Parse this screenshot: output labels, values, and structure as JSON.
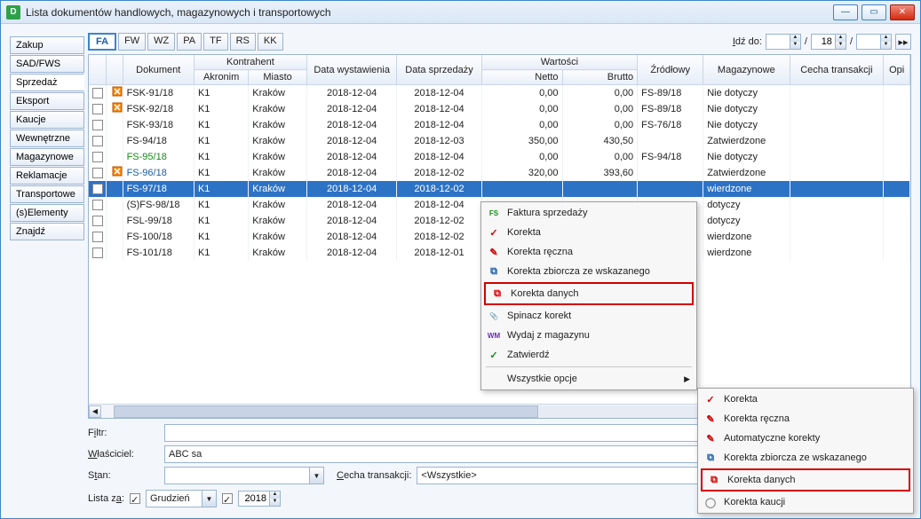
{
  "window": {
    "title": "Lista dokumentów handlowych, magazynowych i transportowych"
  },
  "sidetabs": [
    "Zakup",
    "SAD/FWS",
    "Sprzedaż",
    "Eksport",
    "Kaucje",
    "Wewnętrzne",
    "Magazynowe",
    "Reklamacje",
    "Transportowe",
    "(s)Elementy",
    "Znajdź"
  ],
  "sidetab_active": 2,
  "toptabs": [
    "FA",
    "FW",
    "WZ",
    "PA",
    "TF",
    "RS",
    "KK"
  ],
  "toptab_active": 0,
  "goto": {
    "label": "Idź do:",
    "val1": "",
    "val2": "18",
    "val3": ""
  },
  "columns": {
    "dokument": "Dokument",
    "kontrahent_group": "Kontrahent",
    "akronim": "Akronim",
    "miasto": "Miasto",
    "data_wyst": "Data wystawienia",
    "data_sprz": "Data sprzedaży",
    "wartosci_group": "Wartości",
    "netto": "Netto",
    "brutto": "Brutto",
    "zrodlowy": "Źródłowy",
    "magazynowe": "Magazynowe",
    "cecha": "Cecha transakcji",
    "opi": "Opi"
  },
  "rows": [
    {
      "flag": "r",
      "doc": "FSK-91/18",
      "akr": "K1",
      "miasto": "Kraków",
      "dw": "2018-12-04",
      "ds": "2018-12-04",
      "netto": "0,00",
      "brutto": "0,00",
      "zr": "FS-89/18",
      "mag": "Nie dotyczy"
    },
    {
      "flag": "r",
      "doc": "FSK-92/18",
      "akr": "K1",
      "miasto": "Kraków",
      "dw": "2018-12-04",
      "ds": "2018-12-04",
      "netto": "0,00",
      "brutto": "0,00",
      "zr": "FS-89/18",
      "mag": "Nie dotyczy"
    },
    {
      "flag": "",
      "doc": "FSK-93/18",
      "akr": "K1",
      "miasto": "Kraków",
      "dw": "2018-12-04",
      "ds": "2018-12-04",
      "netto": "0,00",
      "brutto": "0,00",
      "zr": "FS-76/18",
      "mag": "Nie dotyczy"
    },
    {
      "flag": "",
      "doc": "FS-94/18",
      "akr": "K1",
      "miasto": "Kraków",
      "dw": "2018-12-04",
      "ds": "2018-12-03",
      "netto": "350,00",
      "brutto": "430,50",
      "zr": "",
      "mag": "Zatwierdzone"
    },
    {
      "flag": "",
      "doc": "FS-95/18",
      "cls": "doc-green",
      "akr": "K1",
      "miasto": "Kraków",
      "dw": "2018-12-04",
      "ds": "2018-12-04",
      "netto": "0,00",
      "brutto": "0,00",
      "zr": "FS-94/18",
      "mag": "Nie dotyczy"
    },
    {
      "flag": "r",
      "doc": "FS-96/18",
      "cls": "doc-blue",
      "akr": "K1",
      "miasto": "Kraków",
      "dw": "2018-12-04",
      "ds": "2018-12-02",
      "netto": "320,00",
      "brutto": "393,60",
      "zr": "",
      "mag": "Zatwierdzone"
    },
    {
      "flag": "",
      "doc": "FS-97/18",
      "akr": "K1",
      "miasto": "Kraków",
      "dw": "2018-12-04",
      "ds": "2018-12-02",
      "netto": "",
      "brutto": "",
      "zr": "",
      "mag": "wierdzone",
      "sel": true
    },
    {
      "flag": "",
      "doc": "(S)FS-98/18",
      "akr": "K1",
      "miasto": "Kraków",
      "dw": "2018-12-04",
      "ds": "2018-12-04",
      "netto": "",
      "brutto": "",
      "zr": "",
      "mag": "dotyczy"
    },
    {
      "flag": "",
      "doc": "FSL-99/18",
      "akr": "K1",
      "miasto": "Kraków",
      "dw": "2018-12-04",
      "ds": "2018-12-02",
      "netto": "",
      "brutto": "",
      "zr": "",
      "mag": "dotyczy"
    },
    {
      "flag": "",
      "doc": "FS-100/18",
      "akr": "K1",
      "miasto": "Kraków",
      "dw": "2018-12-04",
      "ds": "2018-12-02",
      "netto": "",
      "brutto": "",
      "zr": "",
      "mag": "wierdzone"
    },
    {
      "flag": "",
      "doc": "FS-101/18",
      "akr": "K1",
      "miasto": "Kraków",
      "dw": "2018-12-04",
      "ds": "2018-12-01",
      "netto": "",
      "brutto": "",
      "zr": "",
      "mag": "wierdzone"
    }
  ],
  "filters": {
    "filtr_label": "Filtr:",
    "wlasciciel_label": "Właściciel:",
    "wlasciciel_value": "ABC sa",
    "stan_label": "Stan:",
    "cecha_label": "Cecha transakcji:",
    "cecha_value": "<Wszystkie>",
    "lista_za": "Lista za:",
    "miesiac": "Grudzień",
    "rok": "2018"
  },
  "context1": {
    "items": [
      {
        "icon": "FS",
        "icolor": "#178a17",
        "label": "Faktura sprzedaży"
      },
      {
        "icon": "✓",
        "icolor": "#d40000",
        "label": "Korekta"
      },
      {
        "icon": "✎",
        "icolor": "#d40000",
        "label": "Korekta ręczna"
      },
      {
        "icon": "⧉",
        "icolor": "#1d5fa8",
        "label": "Korekta zbiorcza ze wskazanego"
      },
      {
        "icon": "⧉",
        "icolor": "#d40000",
        "label": "Korekta danych",
        "hl": true
      },
      {
        "icon": "📎",
        "icolor": "#d40000",
        "label": "Spinacz korekt"
      },
      {
        "icon": "WM",
        "icolor": "#6a2bb5",
        "label": "Wydaj z magazynu"
      },
      {
        "icon": "✓",
        "icolor": "#178a17",
        "label": "Zatwierdź"
      }
    ],
    "all_opts": "Wszystkie opcje"
  },
  "context2": {
    "items": [
      {
        "icon": "✓",
        "icolor": "#d40000",
        "label": "Korekta"
      },
      {
        "icon": "✎",
        "icolor": "#d40000",
        "label": "Korekta ręczna"
      },
      {
        "icon": "✎",
        "icolor": "#d40000",
        "label": "Automatyczne korekty"
      },
      {
        "icon": "⧉",
        "icolor": "#1d5fa8",
        "label": "Korekta zbiorcza ze wskazanego"
      },
      {
        "icon": "⧉",
        "icolor": "#d40000",
        "label": "Korekta danych",
        "hl": true
      },
      {
        "icon": "◯",
        "icolor": "#888",
        "label": "Korekta kaucji"
      }
    ]
  }
}
